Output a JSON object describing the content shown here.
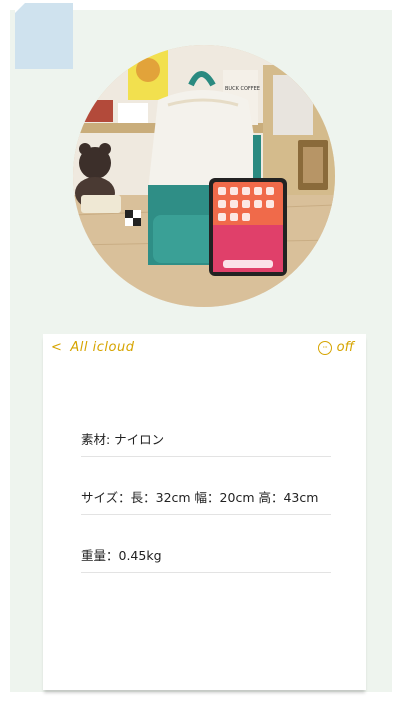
{
  "header": {
    "back_label": "All icloud",
    "back_icon": "chevron-left-icon",
    "right_label": "off",
    "right_icon": "more-dots-icon",
    "accent_color": "#d6a400"
  },
  "photo": {
    "description": "backpack-with-tablet",
    "tote_text": "BUCK COFFEE"
  },
  "specs": [
    {
      "text": "素材: ナイロン"
    },
    {
      "text": "サイズ：長：32cm 幅：20cm 高：43cm"
    },
    {
      "text": "重量：0.45kg"
    }
  ],
  "colors": {
    "frame_bg": "#eef4ee",
    "corner_note": "#cfe2ee",
    "card_bg": "#ffffff"
  }
}
